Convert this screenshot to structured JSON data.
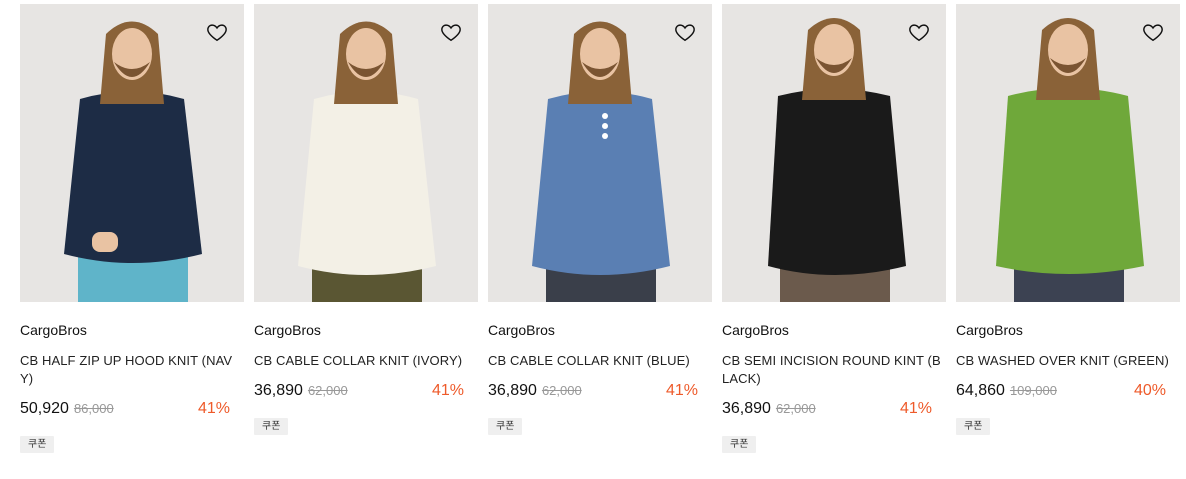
{
  "products": [
    {
      "brand": "CargoBros",
      "title": "CB HALF ZIP UP HOOD KNIT (NAVY)",
      "price": "50,920",
      "original_price": "86,000",
      "discount": "41%",
      "coupon": "쿠폰",
      "knit_color": "#1d2c45",
      "bottom_color": "#5fb4c9"
    },
    {
      "brand": "CargoBros",
      "title": "CB CABLE COLLAR KNIT (IVORY)",
      "price": "36,890",
      "original_price": "62,000",
      "discount": "41%",
      "coupon": "쿠폰",
      "knit_color": "#f3f0e6",
      "bottom_color": "#5a5633"
    },
    {
      "brand": "CargoBros",
      "title": "CB CABLE COLLAR KNIT (BLUE)",
      "price": "36,890",
      "original_price": "62,000",
      "discount": "41%",
      "coupon": "쿠폰",
      "knit_color": "#5a7fb3",
      "bottom_color": "#3a3f4a"
    },
    {
      "brand": "CargoBros",
      "title": "CB SEMI INCISION ROUND KINT (BLACK)",
      "price": "36,890",
      "original_price": "62,000",
      "discount": "41%",
      "coupon": "쿠폰",
      "knit_color": "#1a1a1a",
      "bottom_color": "#6b5a4c"
    },
    {
      "brand": "CargoBros",
      "title": "CB WASHED OVER KNIT (GREEN)",
      "price": "64,860",
      "original_price": "109,000",
      "discount": "40%",
      "coupon": "쿠폰",
      "knit_color": "#6fa83a",
      "bottom_color": "#3c4252"
    }
  ],
  "accent_color": "#ee5a2a",
  "icons": {
    "wishlist": "heart-icon"
  }
}
